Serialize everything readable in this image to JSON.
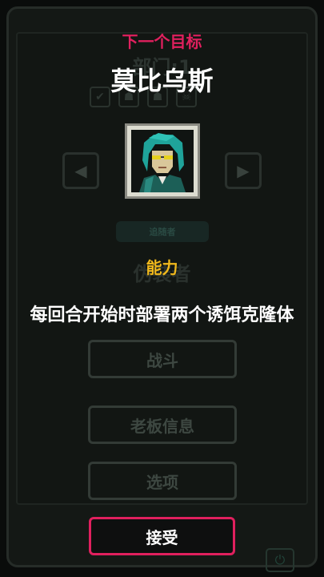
{
  "overlay": {
    "next_target_label": "下一个目标",
    "target_name": "莫比乌斯",
    "ability_label": "能力",
    "ability_text": "每回合开始时部署两个诱饵克隆体",
    "accept_label": "接受"
  },
  "background": {
    "department_title": "部门:1",
    "tag_label": "追随者",
    "role_title": "伪装者",
    "menu": {
      "combat_label": "战斗",
      "boss_info_label": "老板信息",
      "options_label": "选项"
    }
  },
  "colors": {
    "accent_pink": "#e0205e",
    "ability_gold": "#f0b81c"
  },
  "icons": [
    "check-icon",
    "arrow-right-icon",
    "enemy-icon",
    "skull-icon",
    "left-arrow-icon",
    "right-arrow-icon",
    "power-icon"
  ]
}
